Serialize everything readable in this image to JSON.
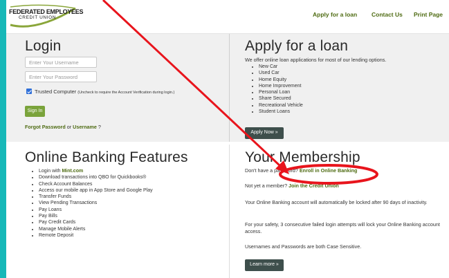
{
  "header": {
    "logo_line1": "FEDERATED EMPLOYEES",
    "logo_line2": "CREDIT UNION",
    "nav": [
      "Apply for a loan",
      "Contact Us",
      "Print Page"
    ]
  },
  "login": {
    "title": "Login",
    "username_placeholder": "Enter Your Username",
    "password_placeholder": "Enter Your Password",
    "trusted_label": "Trusted Computer",
    "trusted_note": "(Uncheck to require the Account Verification during login.)",
    "trusted_checked": true,
    "signin_label": "Sign In",
    "forgot_password": "Forgot Password",
    "or_text": "or",
    "username_link": "Username",
    "question_mark": "?"
  },
  "apply": {
    "title": "Apply for a loan",
    "intro": "We offer online loan applications for most of our lending options.",
    "items": [
      "New Car",
      "Used Car",
      "Home Equity",
      "Home Improvement",
      "Personal Loan",
      "Share Secured",
      "Recreational Vehicle",
      "Student Loans"
    ],
    "button": "Apply Now »"
  },
  "features": {
    "title": "Online Banking Features",
    "first_prefix": "Login with ",
    "first_link": "Mint.com",
    "items": [
      "Download transactions into QBO for Quickbooks®",
      "Check Account Balances",
      "Access our mobile app in App Store and Google Play",
      "Transfer Funds",
      "View Pending Transactions",
      "Pay Loans",
      "Pay Bills",
      "Pay Credit Cards",
      "Manage Mobile Alerts",
      "Remote Deposit"
    ]
  },
  "membership": {
    "title": "Your Membership",
    "p1_prefix": "Don't have a password?",
    "p1_link": "Enroll in Online Banking",
    "p2_prefix": "Not yet a member?",
    "p2_link": "Join the Credit Union",
    "p3": "Your Online Banking account will automatically be locked after 90 days of inactivity.",
    "p4": "For your safety, 3 consecutive failed login attempts will lock your Online Banking account access.",
    "p5": "Usernames and Passwords are both Case Sensitive.",
    "button": "Learn more »"
  },
  "colors": {
    "accent_green": "#4e6b12",
    "button_green": "#7aa33b",
    "annotation_red": "#e8141c",
    "border_teal": "#17b8b8"
  }
}
